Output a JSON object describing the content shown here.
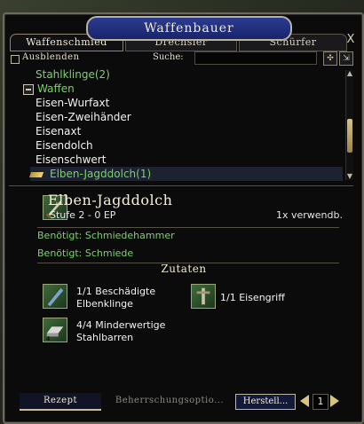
{
  "window": {
    "title": "Waffenbauer",
    "close_symbol": "X"
  },
  "tabs": [
    {
      "label": "Waffenschmied",
      "active": true
    },
    {
      "label": "Drechsler",
      "active": false
    },
    {
      "label": "Schürfer",
      "active": false
    }
  ],
  "controls": {
    "hide_label": "Ausblenden",
    "search_label": "Suche:",
    "search_value": "",
    "search_placeholder": ""
  },
  "recipe_list": [
    {
      "type": "category",
      "label": "Stahlklinge(2)"
    },
    {
      "type": "category",
      "label": "Waffen",
      "collapsible": true
    },
    {
      "type": "item",
      "label": "Eisen-Wurfaxt"
    },
    {
      "type": "item",
      "label": "Eisen-Zweihänder"
    },
    {
      "type": "item",
      "label": "Eisenaxt"
    },
    {
      "type": "item",
      "label": "Eisendolch"
    },
    {
      "type": "item",
      "label": "Eisenschwert"
    },
    {
      "type": "recipe",
      "label": "Elben-Jagddolch(1)",
      "selected": true
    }
  ],
  "details": {
    "item_name": "Elben-Jagddolch",
    "tier": "Stufe 2 - 0 EP",
    "uses": "1x verwendb.",
    "requirements": [
      "Benötigt: Schmiedehammer",
      "Benötigt: Schmiede"
    ],
    "ingredients_title": "Zutaten",
    "ingredients": [
      {
        "label_line1": "1/1 Beschädigte",
        "label_line2": "Elbenklinge"
      },
      {
        "label_line1": "1/1 Eisengriff",
        "label_line2": ""
      },
      {
        "label_line1": "4/4 Minderwertige",
        "label_line2": "Stahlbarren",
        "stack": "4"
      }
    ]
  },
  "footer": {
    "tab_recipe": "Rezept",
    "tab_mastery": "Beherrschungsoptio...",
    "craft_button": "Herstell...",
    "quantity": "1"
  },
  "colors": {
    "category_green": "#7cd26a",
    "title_blue": "#1f2c7a",
    "gold": "#d8c47a"
  }
}
